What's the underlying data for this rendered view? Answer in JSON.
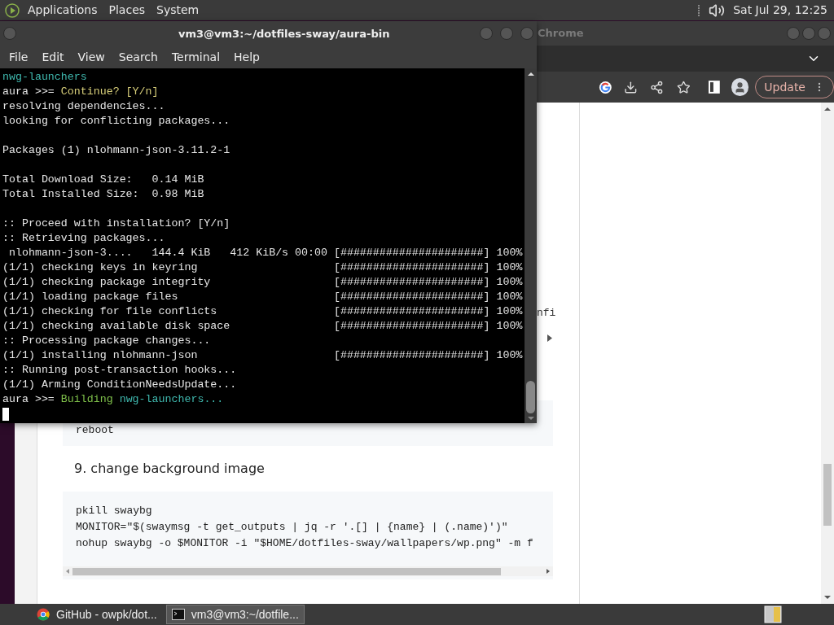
{
  "top_panel": {
    "menus": [
      "Applications",
      "Places",
      "System"
    ],
    "clock": "Sat Jul 29, 12:25"
  },
  "browser": {
    "title": "Chrome",
    "toolbar": {
      "update_button": "Update"
    },
    "page": {
      "fragment": "nfi",
      "code_block_1": [
        "reboot"
      ],
      "heading": "9. change background image",
      "code_block_2": [
        "pkill swaybg",
        "MONITOR=\"$(swaymsg -t get_outputs | jq -r '.[] | {name} | (.name)')\"",
        "nohup swaybg -o $MONITOR -i \"$HOME/dotfiles-sway/wallpapers/wp.png\" -m f"
      ]
    }
  },
  "terminal": {
    "title": "vm3@vm3:~/dotfiles-sway/aura-bin",
    "menu": [
      "File",
      "Edit",
      "View",
      "Search",
      "Terminal",
      "Help"
    ],
    "lines": [
      [
        {
          "text": "nwg-launchers",
          "color": "#3fb8ae"
        }
      ],
      [
        {
          "text": "aura >>= ",
          "color": "#e6e6e6"
        },
        {
          "text": "Continue? [Y/n]",
          "color": "#d8cf7a"
        }
      ],
      [
        {
          "text": "resolving dependencies...",
          "color": "#e6e6e6"
        }
      ],
      [
        {
          "text": "looking for conflicting packages...",
          "color": "#e6e6e6"
        }
      ],
      {
        "kind": "blank"
      },
      [
        {
          "text": "Packages (1) nlohmann-json-3.11.2-1",
          "color": "#e6e6e6"
        }
      ],
      {
        "kind": "blank"
      },
      [
        {
          "text": "Total Download Size:   0.14 MiB",
          "color": "#e6e6e6"
        }
      ],
      [
        {
          "text": "Total Installed Size:  0.98 MiB",
          "color": "#e6e6e6"
        }
      ],
      {
        "kind": "blank"
      },
      [
        {
          "text": ":: Proceed with installation? [Y/n]",
          "color": "#e6e6e6"
        }
      ],
      [
        {
          "text": ":: Retrieving packages...",
          "color": "#e6e6e6"
        }
      ],
      [
        {
          "text": " nlohmann-json-3....   144.4 KiB   412 KiB/s 00:00 [######################] 100%",
          "color": "#e6e6e6"
        }
      ],
      [
        {
          "text": "(1/1) checking keys in keyring                     [######################] 100%",
          "color": "#e6e6e6"
        }
      ],
      [
        {
          "text": "(1/1) checking package integrity                   [######################] 100%",
          "color": "#e6e6e6"
        }
      ],
      [
        {
          "text": "(1/1) loading package files                        [######################] 100%",
          "color": "#e6e6e6"
        }
      ],
      [
        {
          "text": "(1/1) checking for file conflicts                  [######################] 100%",
          "color": "#e6e6e6"
        }
      ],
      [
        {
          "text": "(1/1) checking available disk space                [######################] 100%",
          "color": "#e6e6e6"
        }
      ],
      [
        {
          "text": ":: Processing package changes...",
          "color": "#e6e6e6"
        }
      ],
      [
        {
          "text": "(1/1) installing nlohmann-json                     [######################] 100%",
          "color": "#e6e6e6"
        }
      ],
      [
        {
          "text": ":: Running post-transaction hooks...",
          "color": "#e6e6e6"
        }
      ],
      [
        {
          "text": "(1/1) Arming ConditionNeedsUpdate...",
          "color": "#e6e6e6"
        }
      ],
      [
        {
          "text": "aura >>= ",
          "color": "#e6e6e6"
        },
        {
          "text": "Building ",
          "color": "#7fc04a"
        },
        {
          "text": "nwg-launchers...",
          "color": "#3fb8ae"
        }
      ]
    ]
  },
  "taskbar": [
    {
      "label": "GitHub - owpk/dot...",
      "kind": "browser",
      "selected": false
    },
    {
      "label": "vm3@vm3:~/dotfile...",
      "kind": "terminal",
      "selected": true
    }
  ]
}
